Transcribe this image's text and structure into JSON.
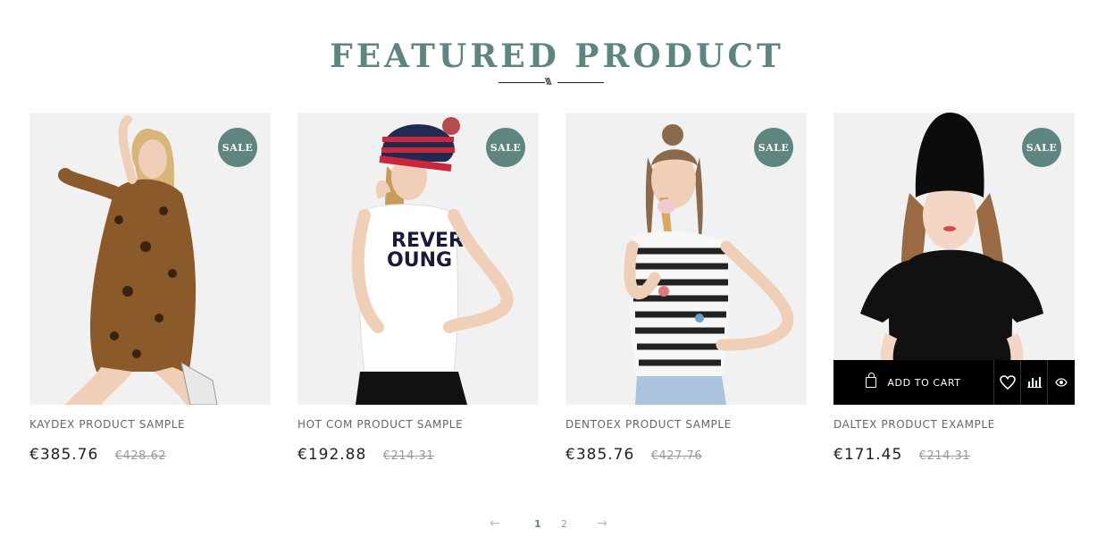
{
  "section": {
    "title": "FEATURED PRODUCT"
  },
  "products": [
    {
      "name": "KAYDEX PRODUCT SAMPLE",
      "price": "€385.76",
      "old_price": "€428.62",
      "badge": "SALE"
    },
    {
      "name": "HOT COM PRODUCT SAMPLE",
      "price": "€192.88",
      "old_price": "€214.31",
      "badge": "SALE"
    },
    {
      "name": "DENTOEX PRODUCT SAMPLE",
      "price": "€385.76",
      "old_price": "€427.76",
      "badge": "SALE"
    },
    {
      "name": "DALTEX PRODUCT EXAMPLE",
      "price": "€171.45",
      "old_price": "€214.31",
      "badge": "SALE"
    }
  ],
  "hover_actions": {
    "add_to_cart": "ADD TO CART",
    "icons": [
      "wishlist-heart-icon",
      "compare-chart-icon",
      "quick-view-eye-icon"
    ]
  },
  "pagination": {
    "prev": "←",
    "pages": [
      "1",
      "2"
    ],
    "current": "1",
    "next": "→"
  },
  "colors": {
    "accent": "#5f8580",
    "action_bar": "#000000",
    "image_bg": "#f2f1f2"
  }
}
